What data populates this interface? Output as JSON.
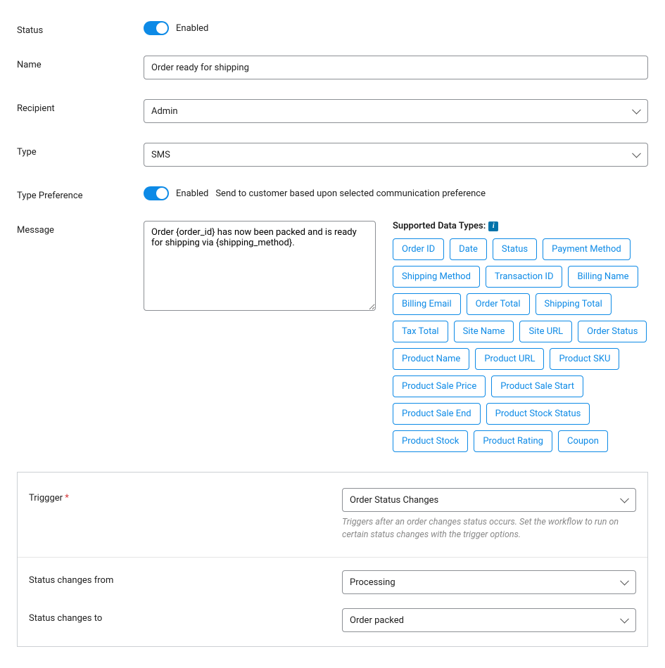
{
  "status": {
    "label": "Status",
    "enabled_text": "Enabled"
  },
  "name": {
    "label": "Name",
    "value": "Order ready for shipping"
  },
  "recipient": {
    "label": "Recipient",
    "value": "Admin"
  },
  "type": {
    "label": "Type",
    "value": "SMS"
  },
  "type_pref": {
    "label": "Type Preference",
    "enabled_text": "Enabled",
    "desc": "Send to customer based upon selected communication preference"
  },
  "message": {
    "label": "Message",
    "value": "Order {order_id} has now been packed and is ready for shipping via {shipping_method}."
  },
  "supported": {
    "title": "Supported Data Types:",
    "tags": [
      "Order ID",
      "Date",
      "Status",
      "Payment Method",
      "Shipping Method",
      "Transaction ID",
      "Billing Name",
      "Billing Email",
      "Order Total",
      "Shipping Total",
      "Tax Total",
      "Site Name",
      "Site URL",
      "Order Status",
      "Product Name",
      "Product URL",
      "Product SKU",
      "Product Sale Price",
      "Product Sale Start",
      "Product Sale End",
      "Product Stock Status",
      "Product Stock",
      "Product Rating",
      "Coupon"
    ]
  },
  "trigger": {
    "label": "Triggger",
    "value": "Order Status Changes",
    "hint": "Triggers after an order changes status occurs. Set the workflow to run on certain status changes with the trigger options."
  },
  "status_from": {
    "label": "Status changes from",
    "value": "Processing"
  },
  "status_to": {
    "label": "Status changes to",
    "value": "Order packed"
  }
}
